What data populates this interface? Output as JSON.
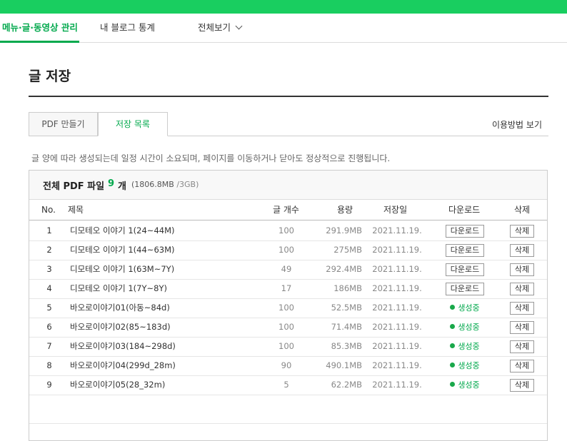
{
  "nav": {
    "items": [
      "메뉴·글·동영상 관리",
      "내 블로그 통계",
      "전체보기"
    ]
  },
  "page_title": "글 저장",
  "tabs": [
    "PDF 만들기",
    "저장 목록"
  ],
  "help_link": "이용방법 보기",
  "notice": "글 양에 따라 생성되는데 일정 시간이 소요되며, 페이지를 이동하거나 닫아도 정상적으로 진행됩니다.",
  "summary": {
    "label": "전체 PDF 파일",
    "count": "9",
    "unit": "개",
    "size_used": "(1806.8MB",
    "size_total": "/3GB)"
  },
  "columns": [
    "No.",
    "제목",
    "글 개수",
    "용량",
    "저장일",
    "다운로드",
    "삭제"
  ],
  "rows": [
    {
      "no": "1",
      "title": "디모테오 이야기 1(24~44M)",
      "count": "100",
      "size": "291.9MB",
      "date": "2021.11.19.",
      "download": "다운로드",
      "status": "",
      "delete": "삭제"
    },
    {
      "no": "2",
      "title": "디모테오 이야기 1(44~63M)",
      "count": "100",
      "size": "275MB",
      "date": "2021.11.19.",
      "download": "다운로드",
      "status": "",
      "delete": "삭제"
    },
    {
      "no": "3",
      "title": "디모테오 이야기 1(63M~7Y)",
      "count": "49",
      "size": "292.4MB",
      "date": "2021.11.19.",
      "download": "다운로드",
      "status": "",
      "delete": "삭제"
    },
    {
      "no": "4",
      "title": "디모테오 이야기 1(7Y~8Y)",
      "count": "17",
      "size": "186MB",
      "date": "2021.11.19.",
      "download": "다운로드",
      "status": "",
      "delete": "삭제"
    },
    {
      "no": "5",
      "title": "바오로이야기01(아동~84d)",
      "count": "100",
      "size": "52.5MB",
      "date": "2021.11.19.",
      "download": "",
      "status": "생성중",
      "delete": "삭제"
    },
    {
      "no": "6",
      "title": "바오로이야기02(85~183d)",
      "count": "100",
      "size": "71.4MB",
      "date": "2021.11.19.",
      "download": "",
      "status": "생성중",
      "delete": "삭제"
    },
    {
      "no": "7",
      "title": "바오로이야기03(184~298d)",
      "count": "100",
      "size": "85.3MB",
      "date": "2021.11.19.",
      "download": "",
      "status": "생성중",
      "delete": "삭제"
    },
    {
      "no": "8",
      "title": "바오로이야기04(299d_28m)",
      "count": "90",
      "size": "490.1MB",
      "date": "2021.11.19.",
      "download": "",
      "status": "생성중",
      "delete": "삭제"
    },
    {
      "no": "9",
      "title": "바오로이야기05(28_32m)",
      "count": "5",
      "size": "62.2MB",
      "date": "2021.11.19.",
      "download": "",
      "status": "생성중",
      "delete": "삭제"
    }
  ]
}
